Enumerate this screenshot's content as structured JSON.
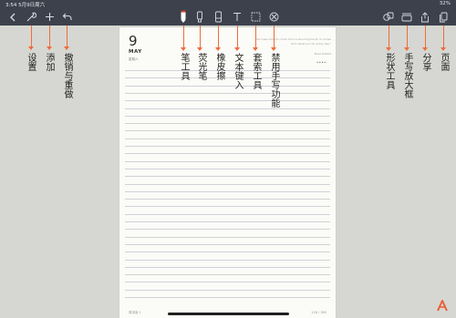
{
  "status_bar": {
    "time": "3:54  5月9日周六",
    "battery": "32%"
  },
  "toolbar": {
    "left": [
      "back-icon",
      "settings-icon",
      "add-icon",
      "undo-icon"
    ],
    "center": [
      "pen-icon",
      "highlighter-icon",
      "eraser-icon",
      "text-icon",
      "lasso-icon",
      "disable-handwriting-icon"
    ],
    "right": [
      "shape-icon",
      "zoom-box-icon",
      "share-icon",
      "pages-icon"
    ],
    "accent_color": "#ffffff"
  },
  "page": {
    "day": "9",
    "month": "MAY",
    "weekday": "星期六",
    "quote": "\"Success doesn't come from a stunning burst; it comes from what you do every day.\"",
    "quote_author": "- Brad Gilbert",
    "dots": "••••",
    "footer_left": "周末版 1",
    "footer_right": "128 / 365"
  },
  "annotations": {
    "settings": "设置",
    "add": "添加",
    "undo_redo": "撤销与重做",
    "pen_tool": "笔工具",
    "highlighter": "荧光笔",
    "eraser": "橡皮擦",
    "text_input": "文本键入",
    "lasso_tool": "套索工具",
    "disable_handwriting": "禁用手写功能",
    "shape_tool": "形状工具",
    "handwriting_zoom": "手写放大框",
    "share": "分享",
    "pages": "页面",
    "arrow_color": "#ef6c3a"
  }
}
